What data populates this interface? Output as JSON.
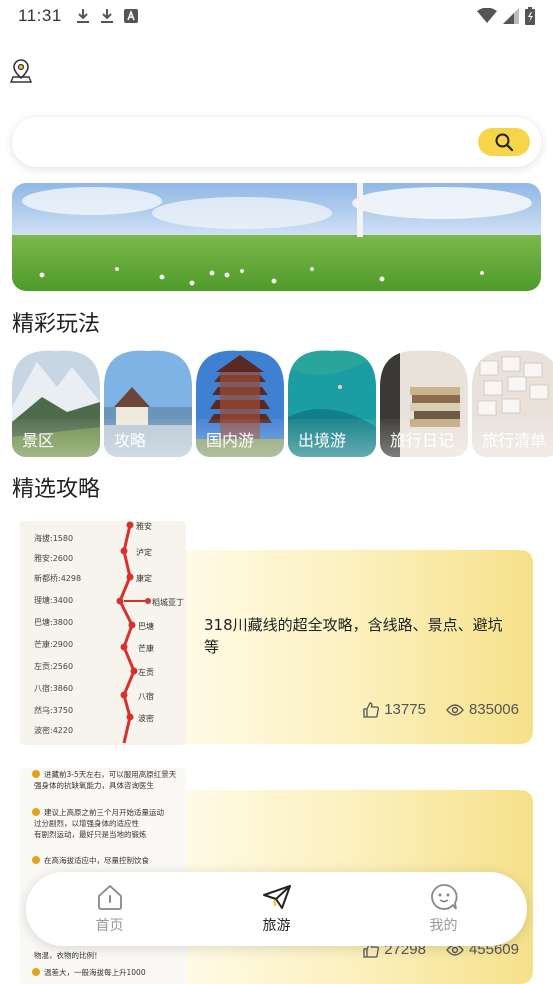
{
  "status_bar": {
    "time": "11:31"
  },
  "search": {
    "placeholder": ""
  },
  "sections": {
    "play_title": "精彩玩法",
    "guide_title": "精选攻略"
  },
  "categories": [
    {
      "label": "景区",
      "icon": "mountain-photo"
    },
    {
      "label": "攻略",
      "icon": "cabin-photo"
    },
    {
      "label": "国内游",
      "icon": "pagoda-photo"
    },
    {
      "label": "出境游",
      "icon": "sea-photo"
    },
    {
      "label": "旅行日记",
      "icon": "books-photo"
    },
    {
      "label": "旅行清单",
      "icon": "notes-photo"
    }
  ],
  "guides": [
    {
      "title": "318川藏线的超全攻略，含线路、景点、避坑等",
      "likes": "13775",
      "views": "835006"
    },
    {
      "title": "",
      "likes": "27298",
      "views": "455609"
    }
  ],
  "nav": [
    {
      "label": "首页",
      "icon": "home-icon",
      "active": false
    },
    {
      "label": "旅游",
      "icon": "paper-plane-icon",
      "active": true
    },
    {
      "label": "我的",
      "icon": "smiley-icon",
      "active": false
    }
  ],
  "colors": {
    "accent": "#f7d54a",
    "card_gradient_end": "#f6e189"
  }
}
